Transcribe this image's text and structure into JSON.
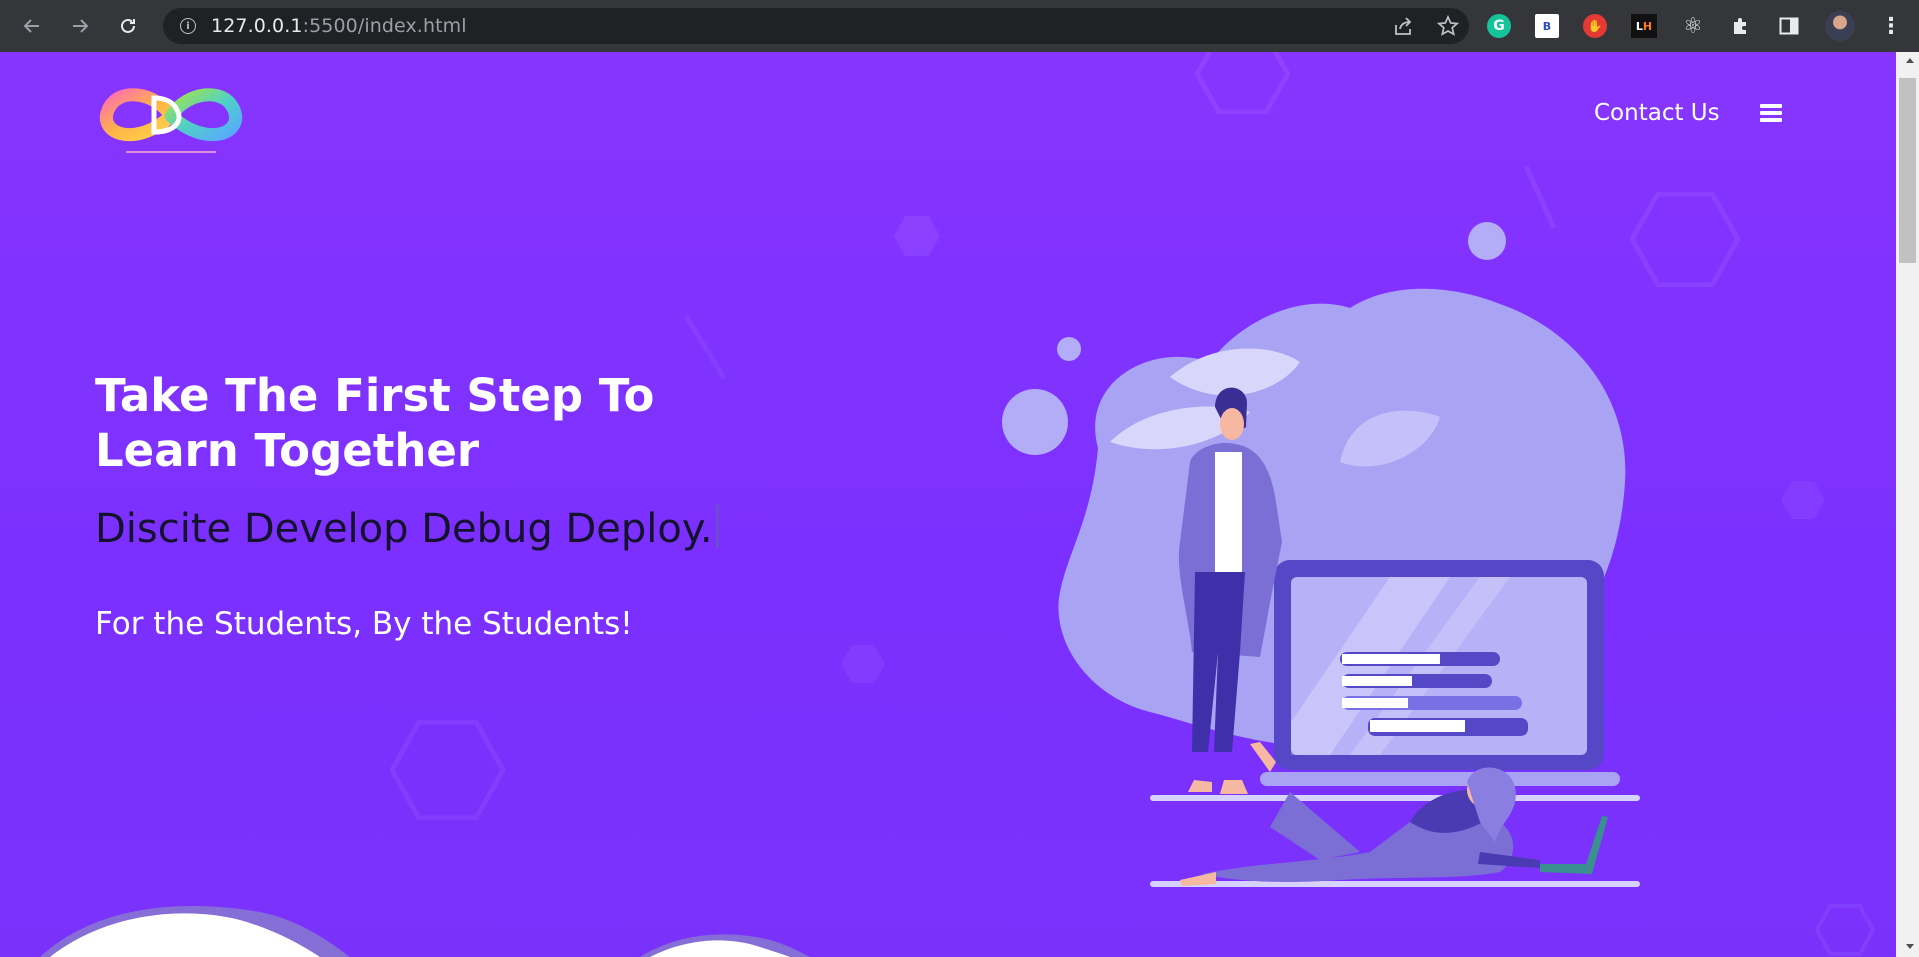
{
  "browser": {
    "url_host": "127.0.0.1",
    "url_path": ":5500/index.html",
    "extensions": [
      {
        "name": "grammarly-icon",
        "label": "G"
      },
      {
        "name": "bx-extension-icon",
        "label": "B"
      },
      {
        "name": "block-extension-icon",
        "label": "✋"
      },
      {
        "name": "lighthouse-icon",
        "label_l": "L",
        "label_h": "H"
      },
      {
        "name": "react-devtools-icon",
        "label": "⚛"
      }
    ]
  },
  "site": {
    "logo_alt": "Discite Develop Debug Deploy",
    "nav": {
      "contact_label": "Contact Us"
    },
    "hero": {
      "title": "Take The First Step To Learn Together",
      "typed_text": "Discite Develop Debug Deploy.",
      "tagline": "For the Students, By the Students!"
    }
  },
  "colors": {
    "background": "#8734ff",
    "accent_light": "#a9a3f4",
    "text_dark": "#14122e",
    "text_light": "#ffffff"
  }
}
